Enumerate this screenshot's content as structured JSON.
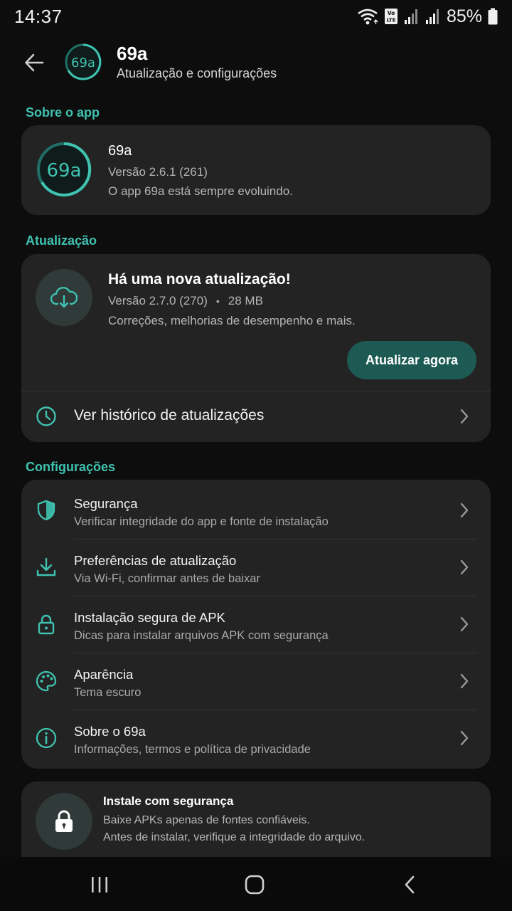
{
  "status_bar": {
    "time": "14:37",
    "battery": "85%",
    "icons": [
      "wifi-icon",
      "volte-icon",
      "signal-icon",
      "signal-icon",
      "battery-icon"
    ]
  },
  "header": {
    "logo_text": "69a",
    "title": "69a",
    "subtitle": "Atualização e configurações",
    "back_icon": "arrow-left-icon"
  },
  "about": {
    "section_label": "Sobre o app",
    "logo_text": "69a",
    "name": "69a",
    "version": "Versão 2.6.1 (261)",
    "description": "O app 69a está sempre evoluindo."
  },
  "update": {
    "section_label": "Atualização",
    "icon": "cloud-download-icon",
    "title": "Há uma nova atualização!",
    "version": "Versão 2.7.0 (270)",
    "separator": "•",
    "size": "28 MB",
    "description": "Correções, melhorias de desempenho e mais.",
    "button_label": "Atualizar agora",
    "history_label": "Ver histórico de atualizações",
    "history_icon": "clock-icon"
  },
  "settings": {
    "section_label": "Configurações",
    "items": [
      {
        "icon": "shield-icon",
        "title": "Segurança",
        "subtitle": "Verificar integridade do app e fonte de instalação"
      },
      {
        "icon": "download-icon",
        "title": "Preferências de atualização",
        "subtitle": "Via Wi-Fi, confirmar antes de baixar"
      },
      {
        "icon": "lock-icon",
        "title": "Instalação segura de APK",
        "subtitle": "Dicas para instalar arquivos APK com segurança"
      },
      {
        "icon": "palette-icon",
        "title": "Aparência",
        "subtitle": "Tema escuro"
      },
      {
        "icon": "info-icon",
        "title": "Sobre o 69a",
        "subtitle": "Informações, termos e política de privacidade"
      }
    ]
  },
  "safe_install": {
    "icon": "lock-icon",
    "title": "Instale com segurança",
    "line1": "Baixe APKs apenas de fontes confiáveis.",
    "line2": "Antes de instalar, verifique a integridade do arquivo."
  },
  "nav": {
    "icons": [
      "recents-icon",
      "home-icon",
      "back-icon"
    ]
  },
  "colors": {
    "accent": "#3fc2b0",
    "button": "#1c5a53",
    "card": "#232323",
    "background": "#0d0d0d"
  }
}
